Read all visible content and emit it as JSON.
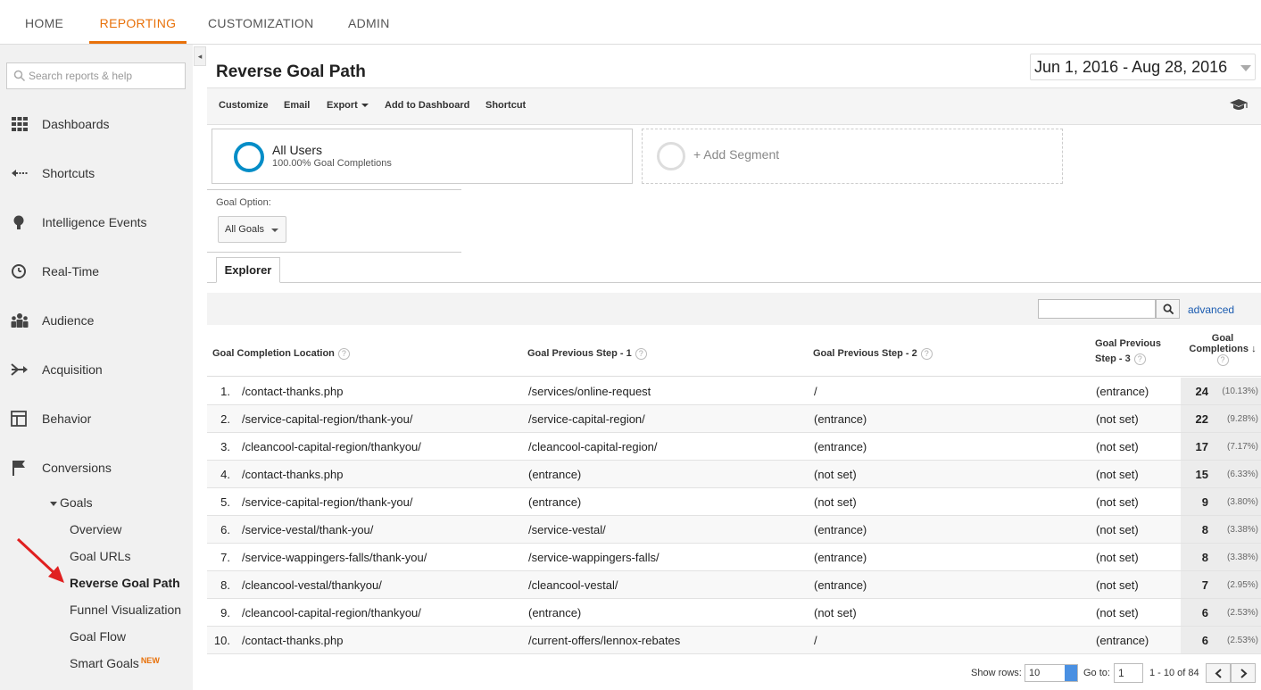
{
  "topnav": {
    "home": "HOME",
    "reporting": "REPORTING",
    "customization": "CUSTOMIZATION",
    "admin": "ADMIN"
  },
  "sidebar": {
    "search_placeholder": "Search reports & help",
    "items": [
      {
        "label": "Dashboards",
        "icon": "grid-icon"
      },
      {
        "label": "Shortcuts",
        "icon": "shortcut-arrow-icon"
      },
      {
        "label": "Intelligence Events",
        "icon": "lightbulb-icon"
      },
      {
        "label": "Real-Time",
        "icon": "clock-icon"
      },
      {
        "label": "Audience",
        "icon": "people-icon"
      },
      {
        "label": "Acquisition",
        "icon": "acquisition-arrows-icon"
      },
      {
        "label": "Behavior",
        "icon": "layout-icon"
      },
      {
        "label": "Conversions",
        "icon": "flag-icon"
      }
    ],
    "goals_label": "Goals",
    "sub_items": [
      "Overview",
      "Goal URLs",
      "Reverse Goal Path",
      "Funnel Visualization",
      "Goal Flow",
      "Smart Goals"
    ],
    "new_badge": "NEW"
  },
  "page": {
    "title": "Reverse Goal Path",
    "date_range": "Jun 1, 2016 - Aug 28, 2016"
  },
  "toolbar": {
    "customize": "Customize",
    "email": "Email",
    "export": "Export",
    "add_to_dashboard": "Add to Dashboard",
    "shortcut": "Shortcut"
  },
  "segment": {
    "name": "All Users",
    "sub": "100.00% Goal Completions",
    "add_label": "+ Add Segment"
  },
  "goal_option": {
    "label": "Goal Option:",
    "value": "All Goals"
  },
  "explorer_tab": "Explorer",
  "filter": {
    "advanced": "advanced"
  },
  "table": {
    "headers": {
      "col1": "Goal Completion Location",
      "col2": "Goal Previous Step - 1",
      "col3": "Goal Previous Step - 2",
      "col4a": "Goal Previous",
      "col4b": "Step - 3",
      "col5a": "Goal",
      "col5b": "Completions",
      "help": "?"
    },
    "rows": [
      {
        "n": "1.",
        "loc": "/contact-thanks.php",
        "s1": "/services/online-request",
        "s2": "/",
        "s3": "(entrance)",
        "val": "24",
        "pct": "(10.13%)"
      },
      {
        "n": "2.",
        "loc": "/service-capital-region/thank-you/",
        "s1": "/service-capital-region/",
        "s2": "(entrance)",
        "s3": "(not set)",
        "val": "22",
        "pct": "(9.28%)"
      },
      {
        "n": "3.",
        "loc": "/cleancool-capital-region/thankyou/",
        "s1": "/cleancool-capital-region/",
        "s2": "(entrance)",
        "s3": "(not set)",
        "val": "17",
        "pct": "(7.17%)"
      },
      {
        "n": "4.",
        "loc": "/contact-thanks.php",
        "s1": "(entrance)",
        "s2": "(not set)",
        "s3": "(not set)",
        "val": "15",
        "pct": "(6.33%)"
      },
      {
        "n": "5.",
        "loc": "/service-capital-region/thank-you/",
        "s1": "(entrance)",
        "s2": "(not set)",
        "s3": "(not set)",
        "val": "9",
        "pct": "(3.80%)"
      },
      {
        "n": "6.",
        "loc": "/service-vestal/thank-you/",
        "s1": "/service-vestal/",
        "s2": "(entrance)",
        "s3": "(not set)",
        "val": "8",
        "pct": "(3.38%)"
      },
      {
        "n": "7.",
        "loc": "/service-wappingers-falls/thank-you/",
        "s1": "/service-wappingers-falls/",
        "s2": "(entrance)",
        "s3": "(not set)",
        "val": "8",
        "pct": "(3.38%)"
      },
      {
        "n": "8.",
        "loc": "/cleancool-vestal/thankyou/",
        "s1": "/cleancool-vestal/",
        "s2": "(entrance)",
        "s3": "(not set)",
        "val": "7",
        "pct": "(2.95%)"
      },
      {
        "n": "9.",
        "loc": "/cleancool-capital-region/thankyou/",
        "s1": "(entrance)",
        "s2": "(not set)",
        "s3": "(not set)",
        "val": "6",
        "pct": "(2.53%)"
      },
      {
        "n": "10.",
        "loc": "/contact-thanks.php",
        "s1": "/current-offers/lennox-rebates",
        "s2": "/",
        "s3": "(entrance)",
        "val": "6",
        "pct": "(2.53%)"
      }
    ]
  },
  "pager": {
    "show_rows_label": "Show rows:",
    "show_rows_value": "10",
    "goto_label": "Go to:",
    "goto_value": "1",
    "range": "1 - 10 of 84"
  },
  "colors": {
    "accent": "#e8710a",
    "link": "#1a5bb0",
    "segment_ring": "#058dc7",
    "annotation_arrow": "#e02020"
  }
}
